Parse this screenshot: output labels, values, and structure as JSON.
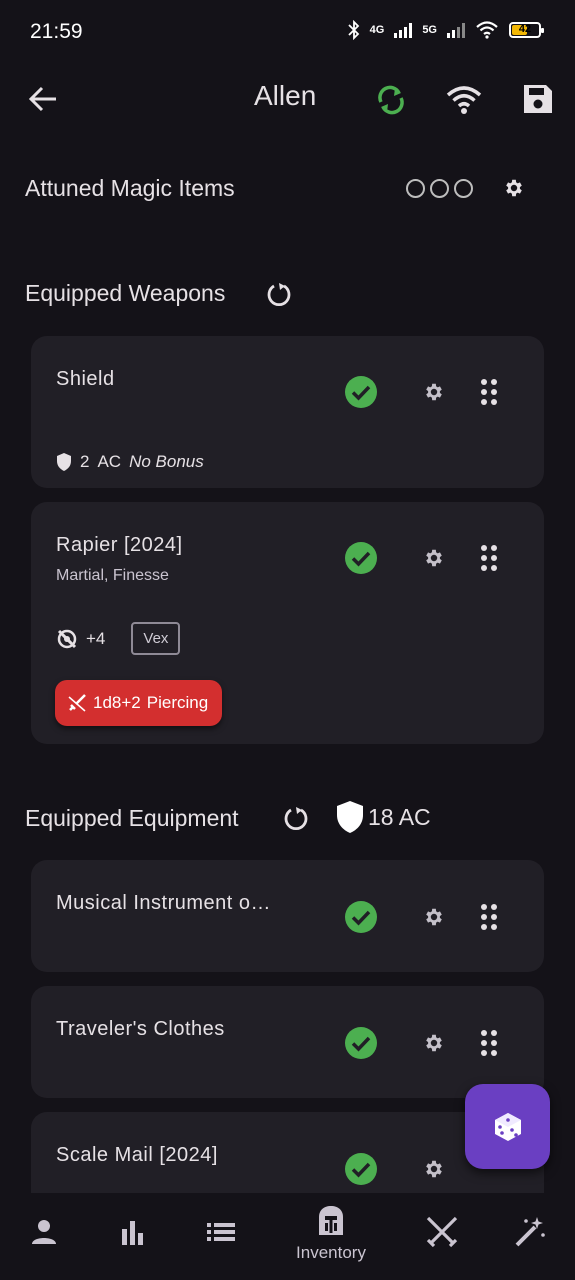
{
  "status": {
    "time": "21:59",
    "net1": "4G",
    "net2": "5G",
    "battery": "42"
  },
  "appbar": {
    "title": "Allen",
    "icons": [
      "back-arrow-icon",
      "sync-icon",
      "wifi-icon",
      "save-icon"
    ],
    "sync_color": "#4caf50"
  },
  "attuned": {
    "heading": "Attuned Magic Items",
    "slots_total": 3,
    "slots_used": 0
  },
  "weapons": {
    "heading": "Equipped Weapons",
    "items": [
      {
        "name": "Shield",
        "ac_value": "2",
        "ac_label": "AC",
        "bonus": "No Bonus",
        "equipped": true
      },
      {
        "name": "Rapier [2024]",
        "properties": "Martial, Finesse",
        "attack_bonus": "+4",
        "mastery": "Vex",
        "damage": "1d8+2",
        "damage_type": "Piercing",
        "equipped": true
      }
    ]
  },
  "equipment": {
    "heading": "Equipped Equipment",
    "ac_total": "18 AC",
    "items": [
      {
        "name": "Musical Instrument o…",
        "equipped": true
      },
      {
        "name": "Traveler's Clothes",
        "equipped": true
      },
      {
        "name": "Scale Mail [2024]",
        "equipped": true
      }
    ]
  },
  "fab": {
    "icon": "dice-icon",
    "color": "#6a3fc2"
  },
  "nav": {
    "items": [
      {
        "icon": "person-icon"
      },
      {
        "icon": "bar-chart-icon"
      },
      {
        "icon": "list-icon"
      },
      {
        "icon": "helmet-icon",
        "label": "Inventory",
        "active": true
      },
      {
        "icon": "crossed-swords-icon"
      },
      {
        "icon": "magic-wand-icon"
      }
    ]
  },
  "colors": {
    "background": "#141218",
    "card": "#211f26",
    "check": "#4caf50",
    "damage_chip": "#d32f2f"
  }
}
